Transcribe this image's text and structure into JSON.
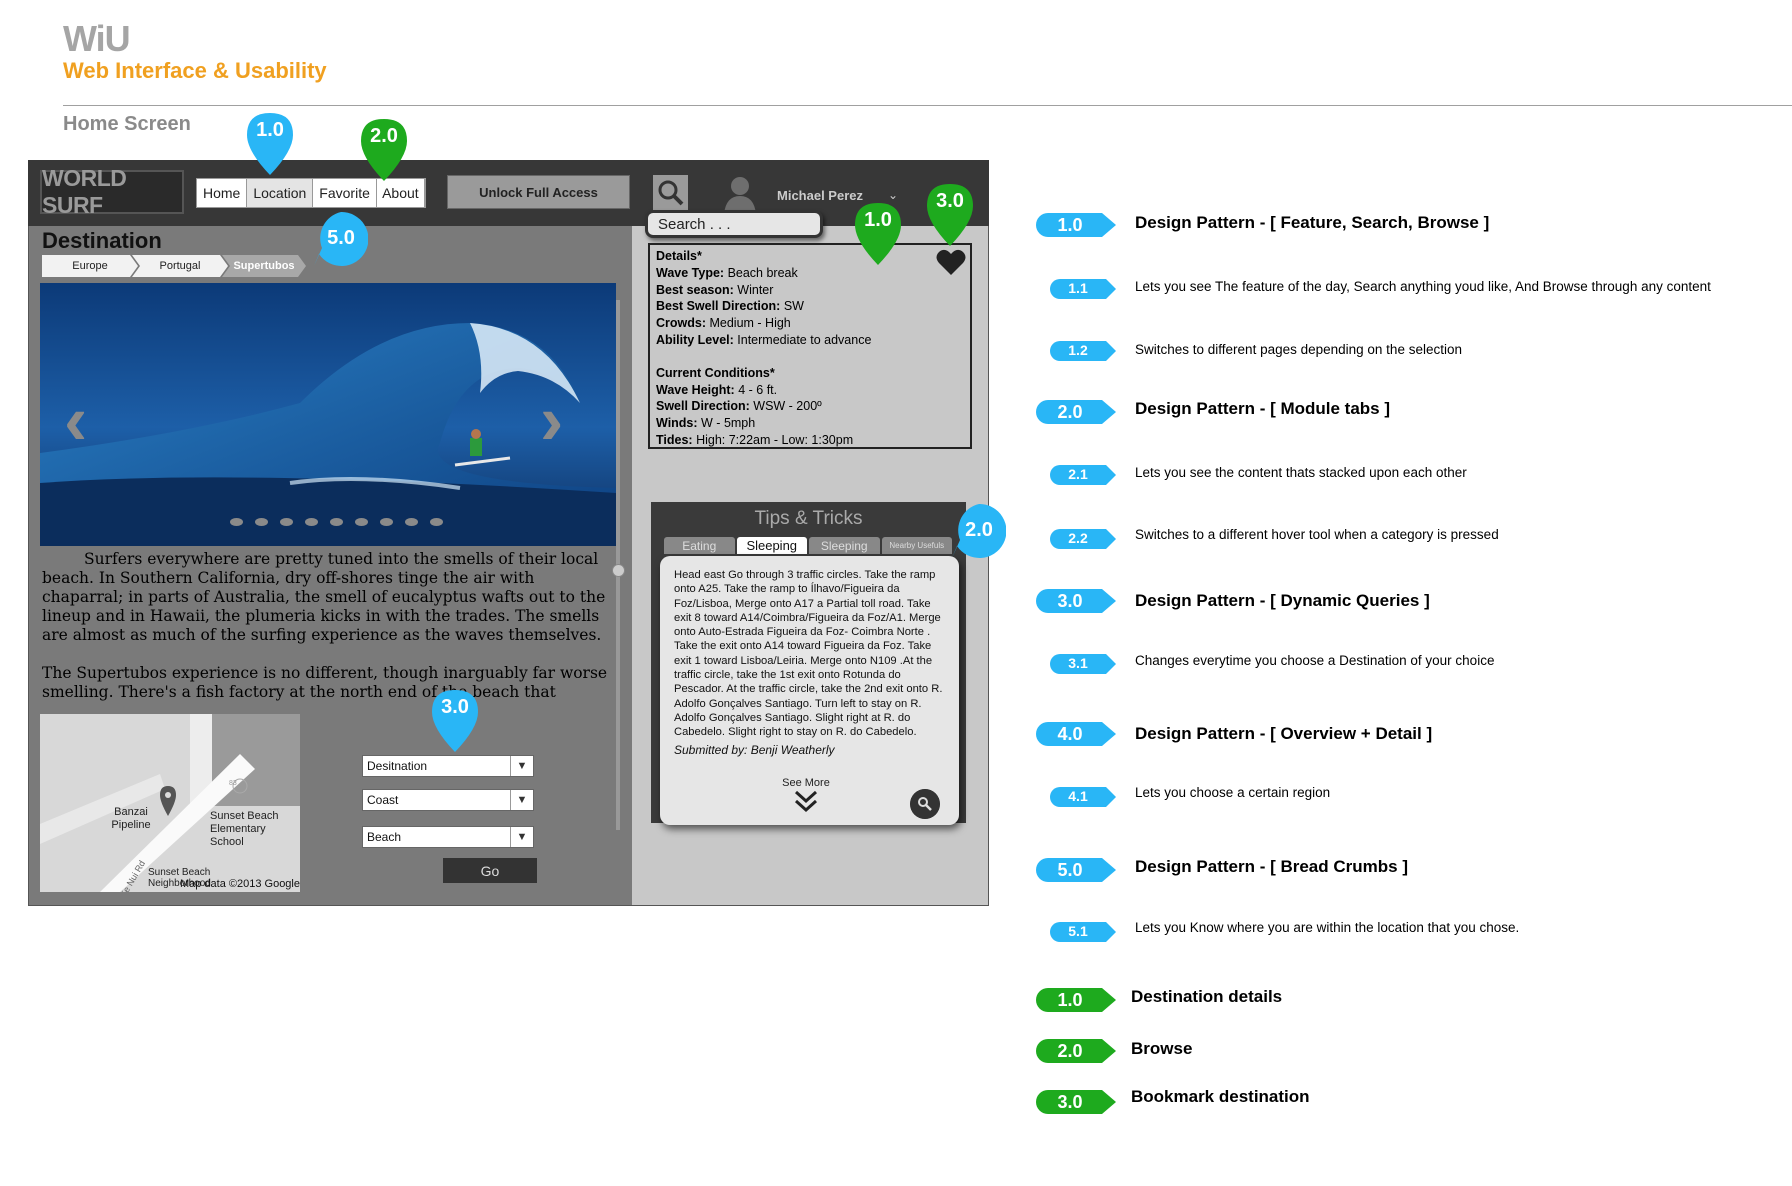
{
  "doc": {
    "title": "WiU",
    "subtitle": "Web Interface & Usability",
    "screen_name": "Home Screen"
  },
  "app": {
    "logo": "WORLD SURF",
    "nav": [
      "Home",
      "Location",
      "Favorite",
      "About"
    ],
    "nav_selected": "Location",
    "unlock_label": "Unlock Full Access",
    "user_name": "Michael Perez",
    "search_placeholder": "Search . . .",
    "destination_title": "Destination",
    "breadcrumbs": [
      "Europe",
      "Portugal",
      "Supertubos"
    ],
    "article": [
      "Surfers everywhere are pretty tuned into the smells of their local beach. In Southern California, dry off-shores tinge the air with chaparral; in parts of Australia, the smell of eucalyptus wafts out to the lineup and in Hawaii, the plumeria kicks in with the trades. The smells are almost as much of the surfing experience as the waves themselves.",
      "The Supertubos experience is no different, though inarguably far worse smelling. There's a fish factory at the north end of the beach that pumps out"
    ],
    "map": {
      "labels": [
        "Banzai Pipeline",
        "Sunset Beach Elementary School",
        "Sunset Beach Neighborhood",
        "Map data ©2013 Google",
        "83",
        "Ke Nui Rd"
      ]
    },
    "filters": [
      "Desitnation",
      "Coast",
      "Beach"
    ],
    "go_label": "Go",
    "details": {
      "heading": "Details*",
      "rows": [
        {
          "k": "Wave Type:",
          "v": "Beach break"
        },
        {
          "k": "Best season:",
          "v": "Winter"
        },
        {
          "k": "Best Swell Direction:",
          "v": "SW"
        },
        {
          "k": "Crowds:",
          "v": "Medium - High"
        },
        {
          "k": "Ability Level:",
          "v": "Intermediate to advance"
        }
      ],
      "conditions_heading": "Current Conditions*",
      "conditions": [
        {
          "k": "Wave Height:",
          "v": "4 - 6 ft."
        },
        {
          "k": "Swell Direction:",
          "v": "WSW - 200º"
        },
        {
          "k": "Winds:",
          "v": "W - 5mph"
        },
        {
          "k": "Tides:",
          "v": "High: 7:22am - Low: 1:30pm"
        }
      ]
    },
    "tips": {
      "title": "Tips & Tricks",
      "tabs": [
        "Eating",
        "Sleeping",
        "Sleeping",
        "Nearby Usefuls"
      ],
      "selected_tab": "Sleeping",
      "text": "Head east Go through 3 traffic circles. Take the ramp onto A25. Take the ramp to Ílhavo/Figueira da Foz/Lisboa, Merge onto A17 a Partial toll road. Take exit 8 toward A14/Coimbra/Figueira da Foz/A1. Merge onto Auto-Estrada Figueira da Foz- Coimbra Norte . Take the exit onto A14 toward Figueira da Foz. Take exit 1 toward Lisboa/Leiria. Merge onto N109 .At the traffic circle, take the 1st exit onto Rotunda do Pescador. At the traffic circle, take the 2nd exit onto R. Adolfo Gonçalves Santiago. Turn left to stay on R. Adolfo Gonçalves Santiago. Slight right at R. do Cabedelo. Slight right to stay on R. do Cabedelo.",
      "submitted_by": "Submitted by: Benji Weatherly",
      "see_more": "See More"
    }
  },
  "markers": {
    "blue_color": "#29b6f6",
    "green_color": "#1eaa1e",
    "pins": [
      "1.0",
      "2.0",
      "1.0",
      "3.0",
      "3.0"
    ],
    "bubbles": [
      "5.0",
      "2.0"
    ]
  },
  "legend": {
    "patterns": [
      {
        "num": "1.0",
        "title": "Design Pattern - [ Feature, Search, Browse ]"
      },
      {
        "num": "1.1",
        "desc": "Lets you see The feature of the day, Search anything youd like, And Browse through any content"
      },
      {
        "num": "1.2",
        "desc": "Switches to different pages depending on the selection"
      },
      {
        "num": "2.0",
        "title": "Design Pattern - [ Module tabs  ]"
      },
      {
        "num": "2.1",
        "desc": "Lets you see the content thats stacked upon each other"
      },
      {
        "num": "2.2",
        "desc": "Switches to a different hover tool when a category is pressed"
      },
      {
        "num": "3.0",
        "title": "Design Pattern - [ Dynamic Queries ]"
      },
      {
        "num": "3.1",
        "desc": "Changes everytime you choose a Destination of your choice"
      },
      {
        "num": "4.0",
        "title": "Design Pattern - [ Overview + Detail ]"
      },
      {
        "num": "4.1",
        "desc": "Lets you choose a certain region"
      },
      {
        "num": "5.0",
        "title": "Design Pattern - [ Bread Crumbs ]"
      },
      {
        "num": "5.1",
        "desc": "Lets you Know where you are within the location that you chose."
      }
    ],
    "features": [
      {
        "num": "1.0",
        "title": "Destination details"
      },
      {
        "num": "2.0",
        "title": "Browse"
      },
      {
        "num": "3.0",
        "title": "Bookmark destination"
      }
    ]
  }
}
